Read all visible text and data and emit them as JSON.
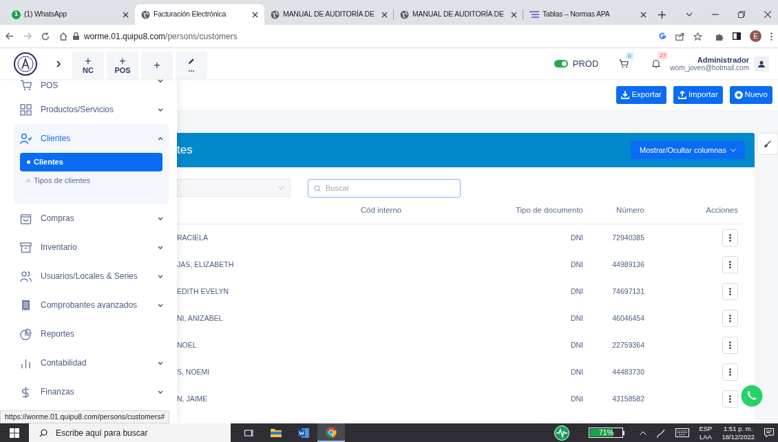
{
  "browser": {
    "tabs": [
      {
        "title": "(1) WhatsApp",
        "badge": "1",
        "selected": false
      },
      {
        "title": "Facturación Electrónica",
        "selected": true
      },
      {
        "title": "MANUAL DE AUDITORÍA DE",
        "selected": false
      },
      {
        "title": "MANUAL DE AUDITORÍA DE",
        "selected": false
      },
      {
        "title": "Tablas – Normas APA",
        "selected": false
      }
    ],
    "url_host": "worme.01.quipu8.com",
    "url_path": "/persons/customers",
    "profile_initial": "E"
  },
  "app_header": {
    "quick_actions": [
      {
        "symbol": "+",
        "label": "NC"
      },
      {
        "symbol": "+",
        "label": "POS"
      },
      {
        "symbol": "+"
      },
      {
        "label": "..."
      }
    ],
    "environment": {
      "label": "PROD",
      "on": true
    },
    "cart_count": "0",
    "notification_count": "27",
    "user": {
      "name": "Administrador",
      "email": "wom_joven@hotmail.com"
    }
  },
  "sidebar": {
    "items": [
      {
        "label": "POS",
        "expandable": true,
        "expanded": false
      },
      {
        "label": "Productos/Servicios",
        "expandable": true,
        "expanded": false
      },
      {
        "label": "Clientes",
        "expandable": true,
        "expanded": true,
        "children": [
          {
            "label": "Clientes",
            "selected": true
          },
          {
            "label": "Tipos de clientes",
            "selected": false
          }
        ]
      },
      {
        "label": "Compras",
        "expandable": true,
        "expanded": false
      },
      {
        "label": "Inventario",
        "expandable": true,
        "expanded": false
      },
      {
        "label": "Usuarios/Locales & Series",
        "expandable": true,
        "expanded": false
      },
      {
        "label": "Comprobantes avanzados",
        "expandable": true,
        "expanded": false
      },
      {
        "label": "Reportes",
        "expandable": false,
        "expanded": false
      },
      {
        "label": "Contabilidad",
        "expandable": true,
        "expanded": false
      },
      {
        "label": "Finanzas",
        "expandable": true,
        "expanded": false
      }
    ]
  },
  "toolbar": {
    "buttons": [
      {
        "label": "Exportar",
        "kind": "download"
      },
      {
        "label": "Importar",
        "kind": "upload"
      },
      {
        "label": "Nuevo",
        "kind": "plus"
      }
    ]
  },
  "card": {
    "title": "tes",
    "columns_button": "Mostrar/Ocultar columnas",
    "search": {
      "placeholder": "Buscar"
    },
    "columns": [
      "Cód interno",
      "Tipo de documento",
      "Número",
      "Acciones"
    ],
    "rows": [
      {
        "name": "RACIELA",
        "doc_type": "DNI",
        "number": "72940385"
      },
      {
        "name": "JAS, ELIZABETH",
        "doc_type": "DNI",
        "number": "44989136"
      },
      {
        "name": "EDITH EVELYN",
        "doc_type": "DNI",
        "number": "74697131"
      },
      {
        "name": "NI, ANIZABEL",
        "doc_type": "DNI",
        "number": "46046454"
      },
      {
        "name": "NOEL",
        "doc_type": "DNI",
        "number": "22759364"
      },
      {
        "name": "S, NOEMI",
        "doc_type": "DNI",
        "number": "44483730"
      },
      {
        "name": "N, JAIME",
        "doc_type": "DNI",
        "number": "43158582"
      }
    ]
  },
  "status_url": "https://worme.01.quipu8.com/persons/customers#",
  "taskbar": {
    "search_placeholder": "Escribe aquí para buscar",
    "battery": "71%",
    "language": "ESP",
    "layout": "LAA",
    "time": "1:51 p. m.",
    "date": "18/12/2022"
  }
}
